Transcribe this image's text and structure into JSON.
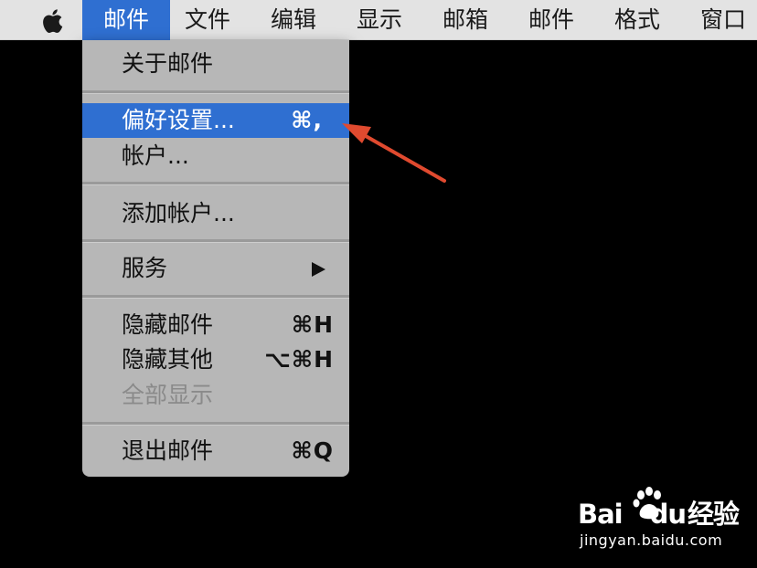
{
  "menubar": {
    "apple_icon": "apple-logo-icon",
    "items": [
      {
        "label": "邮件",
        "active": true
      },
      {
        "label": "文件"
      },
      {
        "label": "编辑"
      },
      {
        "label": "显示"
      },
      {
        "label": "邮箱"
      },
      {
        "label": "邮件"
      },
      {
        "label": "格式"
      },
      {
        "label": "窗口"
      }
    ]
  },
  "dropdown": {
    "items": [
      {
        "label": "关于邮件",
        "shortcut": ""
      },
      {
        "label": "偏好设置...",
        "shortcut": "⌘,",
        "highlighted": true
      },
      {
        "label": "帐户...",
        "shortcut": ""
      },
      {
        "label": "添加帐户...",
        "shortcut": ""
      },
      {
        "label": "服务",
        "shortcut": "",
        "submenu": true
      },
      {
        "label": "隐藏邮件",
        "shortcut": "⌘H"
      },
      {
        "label": "隐藏其他",
        "shortcut": "⌥⌘H"
      },
      {
        "label": "全部显示",
        "shortcut": "",
        "disabled": true
      },
      {
        "label": "退出邮件",
        "shortcut": "⌘Q"
      }
    ]
  },
  "annotation": {
    "arrow_color": "#e04a2f"
  },
  "watermark": {
    "brand_latin_1": "Bai",
    "brand_latin_2": "du",
    "brand_cn": "经验",
    "url": "jingyan.baidu.com"
  },
  "colors": {
    "menubar_bg": "#e3e3e3",
    "highlight": "#2f6fd1",
    "menu_bg": "#b7b7b7",
    "desktop": "#000000"
  }
}
